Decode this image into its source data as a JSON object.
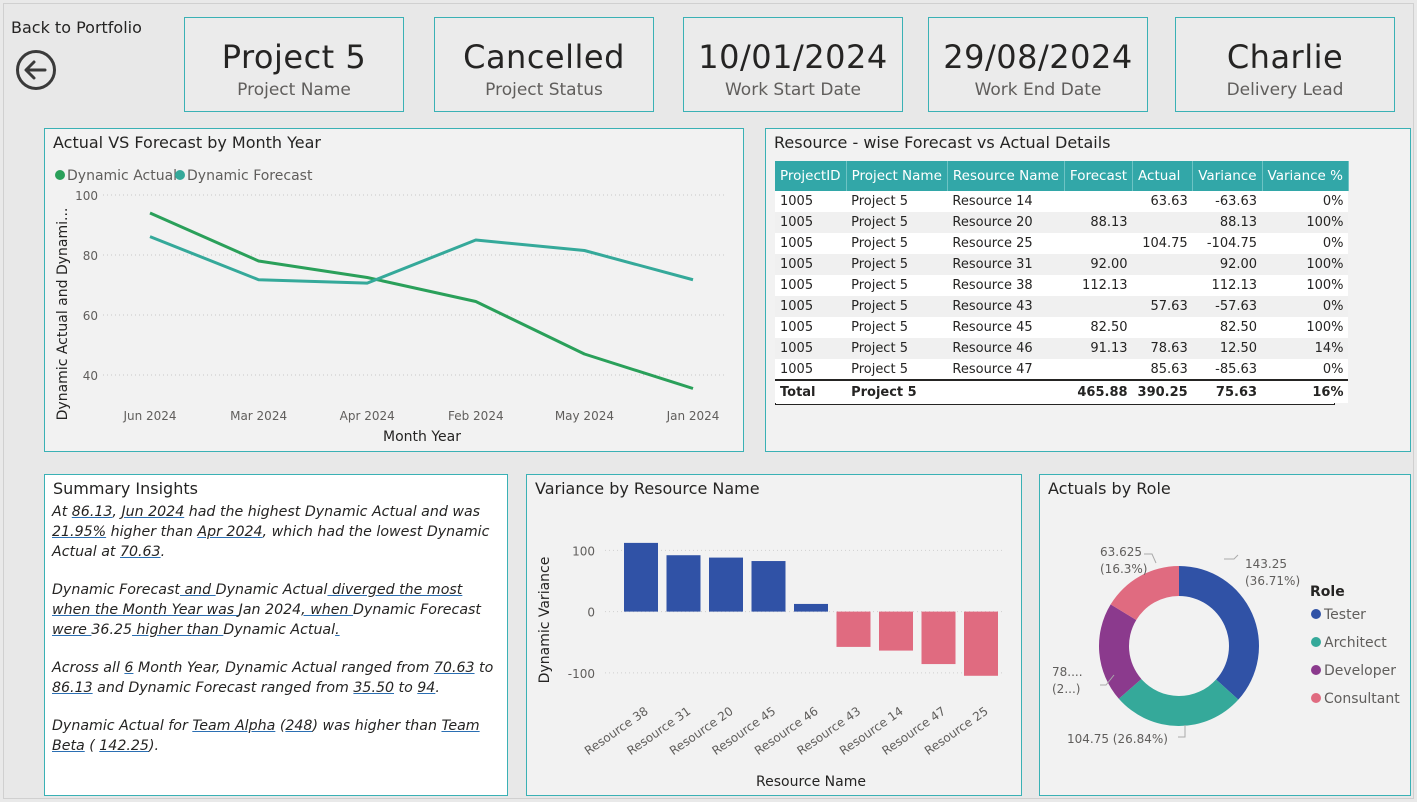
{
  "nav": {
    "back_label": "Back to Portfolio",
    "back_icon": "arrow-left-circle-icon"
  },
  "cards": [
    {
      "value": "Project 5",
      "label": "Project Name"
    },
    {
      "value": "Cancelled",
      "label": "Project Status"
    },
    {
      "value": "10/01/2024",
      "label": "Work Start Date"
    },
    {
      "value": "29/08/2024",
      "label": "Work End Date"
    },
    {
      "value": "Charlie",
      "label": "Delivery Lead"
    }
  ],
  "colors": {
    "actual": "#2aa05a",
    "forecast": "#35a99a",
    "accent": "#3ab1b5",
    "positive": "#3052a6",
    "negative": "#e06b80",
    "tester": "#3052a6",
    "architect": "#35a99a",
    "developer": "#8b3a8d",
    "consultant": "#e06b80"
  },
  "line_panel": {
    "title": "Actual VS Forecast by Month Year",
    "legend": [
      "Dynamic Actual",
      "Dynamic Forecast"
    ]
  },
  "table_panel": {
    "title": "Resource - wise Forecast vs Actual Details",
    "headers": [
      "ProjectID",
      "Project Name",
      "Resource Name",
      "Forecast",
      "Actual",
      "Variance",
      "Variance %"
    ],
    "rows": [
      [
        "1005",
        "Project 5",
        "Resource 14",
        "",
        "63.63",
        "-63.63",
        "0%"
      ],
      [
        "1005",
        "Project 5",
        "Resource 20",
        "88.13",
        "",
        "88.13",
        "100%"
      ],
      [
        "1005",
        "Project 5",
        "Resource 25",
        "",
        "104.75",
        "-104.75",
        "0%"
      ],
      [
        "1005",
        "Project 5",
        "Resource 31",
        "92.00",
        "",
        "92.00",
        "100%"
      ],
      [
        "1005",
        "Project 5",
        "Resource 38",
        "112.13",
        "",
        "112.13",
        "100%"
      ],
      [
        "1005",
        "Project 5",
        "Resource 43",
        "",
        "57.63",
        "-57.63",
        "0%"
      ],
      [
        "1005",
        "Project 5",
        "Resource 45",
        "82.50",
        "",
        "82.50",
        "100%"
      ],
      [
        "1005",
        "Project 5",
        "Resource 46",
        "91.13",
        "78.63",
        "12.50",
        "14%"
      ],
      [
        "1005",
        "Project 5",
        "Resource 47",
        "",
        "85.63",
        "-85.63",
        "0%"
      ]
    ],
    "total": [
      "Total",
      "Project 5",
      "",
      "465.88",
      "390.25",
      "75.63",
      "16%"
    ]
  },
  "insights": {
    "title": "Summary Insights",
    "p1": [
      "At ",
      "86.13",
      ", ",
      "Jun 2024",
      " had the highest Dynamic Actual and was ",
      "21.95%",
      " higher than ",
      "Apr 2024",
      ", which had the lowest Dynamic Actual at ",
      "70.63",
      "."
    ],
    "p2": [
      "Dynamic Forecast",
      " and ",
      "Dynamic Actual",
      " diverged the most when the Month Year was ",
      "Jan 2024",
      ", when ",
      "Dynamic Forecast",
      " were ",
      "36.25",
      " higher than ",
      "Dynamic Actual",
      "."
    ],
    "p3": [
      "Across all ",
      "6",
      " Month Year, Dynamic Actual ranged from ",
      "70.63",
      " to ",
      "86.13",
      " and Dynamic Forecast ranged from ",
      "35.50",
      " to ",
      "94",
      "."
    ],
    "p4": [
      "Dynamic Actual for ",
      "Team Alpha",
      " (",
      "248",
      ") was higher than ",
      "Team Beta",
      " ( ",
      "142.25",
      ")."
    ]
  },
  "bar_panel": {
    "title": "Variance by Resource Name"
  },
  "donut_panel": {
    "title": "Actuals by Role",
    "legend_title": "Role"
  },
  "chart_data": [
    {
      "type": "line",
      "title": "Actual VS Forecast by Month Year",
      "xlabel": "Month Year",
      "ylabel": "Dynamic Actual and Dynami...",
      "categories": [
        "Jun 2024",
        "Mar 2024",
        "Apr 2024",
        "Feb 2024",
        "May 2024",
        "Jan 2024"
      ],
      "series": [
        {
          "name": "Dynamic Actual",
          "values": [
            94,
            78,
            72.5,
            64.5,
            47,
            35.5
          ]
        },
        {
          "name": "Dynamic Forecast",
          "values": [
            86.13,
            71.75,
            70.63,
            85,
            81.5,
            71.75
          ]
        }
      ],
      "ylim": [
        32,
        102
      ],
      "yticks": [
        40,
        60,
        80,
        100
      ]
    },
    {
      "type": "bar",
      "title": "Variance by Resource Name",
      "xlabel": "Resource Name",
      "ylabel": "Dynamic Variance",
      "categories": [
        "Resource 38",
        "Resource 31",
        "Resource 20",
        "Resource 45",
        "Resource 46",
        "Resource 43",
        "Resource 14",
        "Resource 47",
        "Resource 25"
      ],
      "values": [
        112.13,
        92,
        88.13,
        82.5,
        12.5,
        -57.63,
        -63.63,
        -85.63,
        -104.75
      ],
      "ylim": [
        -110,
        125
      ],
      "yticks": [
        100,
        0,
        -100
      ]
    },
    {
      "type": "pie",
      "title": "Actuals by Role",
      "categories": [
        "Tester",
        "Architect",
        "Developer",
        "Consultant"
      ],
      "values": [
        143.25,
        104.75,
        78.63,
        63.625
      ],
      "labels": [
        "143.25 (36.71%)",
        "104.75 (26.84%)",
        "78.... (2...)",
        "63.625 (16.3%)"
      ]
    }
  ]
}
